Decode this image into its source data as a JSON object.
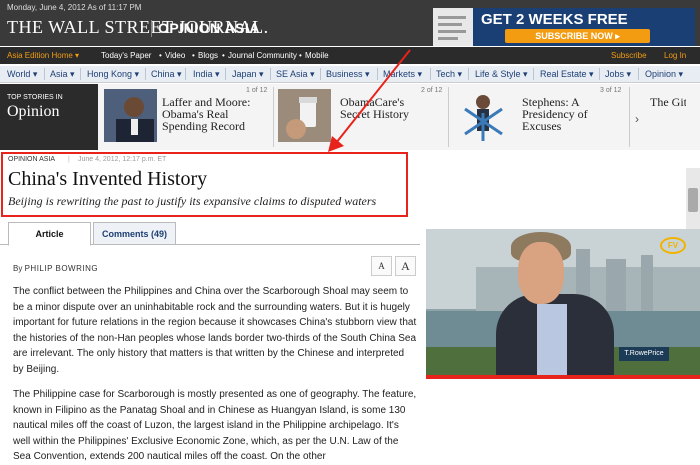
{
  "masthead": {
    "date": "Monday, June 4, 2012 As of 11:17 PM",
    "logo": "THE WALL STREET JOURNAL.",
    "section": "OPINION ASIA"
  },
  "ad": {
    "title": "GET 2 WEEKS FREE",
    "button": "SUBSCRIBE NOW ▸"
  },
  "topnav": {
    "edition": "Asia Edition Home ▾",
    "items": [
      "Today's Paper",
      "Video",
      "Blogs",
      "Journal Community",
      "Mobile"
    ],
    "subscribe": "Subscribe",
    "login": "Log In"
  },
  "secnav": {
    "items": [
      "World ▾",
      "Asia ▾",
      "Hong Kong ▾",
      "China ▾",
      "India ▾",
      "Japan ▾",
      "SE Asia ▾",
      "Business ▾",
      "Markets ▾",
      "Tech ▾",
      "Life & Style ▾",
      "Real Estate ▾",
      "Jobs ▾",
      "Opinion ▾"
    ]
  },
  "top_stories": {
    "label_small": "TOP STORIES IN",
    "label_big": "Opinion",
    "stories": [
      {
        "title": "Laffer and Moore: Obama's Real Spending Record",
        "count": "1 of 12"
      },
      {
        "title": "ObamaCare's Secret History",
        "count": "2 of 12"
      },
      {
        "title": "Stephens: A Presidency of Excuses",
        "count": "3 of 12"
      },
      {
        "title": "The Git"
      }
    ]
  },
  "article": {
    "kicker": "OPINION ASIA",
    "date": "June 4, 2012, 12:17 p.m. ET",
    "headline": "China's Invented History",
    "deck": "Beijing is rewriting the past to justify its expansive claims to disputed waters",
    "tab_article": "Article",
    "tab_comments": "Comments (49)",
    "by": "By",
    "author": "PHILIP BOWRING",
    "font_small": "A",
    "font_large": "A",
    "para1": "The conflict between the Philippines and China over the Scarborough Shoal may seem to be a minor dispute over an uninhabitable rock and the surrounding waters. But it is hugely important for future relations in the region because it showcases China's stubborn view that the histories of the non-Han peoples whose lands border two-thirds of the South China Sea are irrelevant. The only history that matters is that written by the Chinese and interpreted by Beijing.",
    "para2": "The Philippine case for Scarborough is mostly presented as one of geography. The feature, known in Filipino as the Panatag Shoal and in Chinese as Huangyan Island, is some 130 nautical miles off the coast of Luzon, the largest island in the Philippine archipelago. It's well within the Philippines' Exclusive Economic Zone, which, as per the U.N. Law of the Sea Convention, extends 200 nautical miles off the coast. On the other"
  },
  "video": {
    "logo": "FV",
    "brand": "T.RowePrice"
  },
  "colors": {
    "highlight": "#e8231b",
    "accent": "#f39c12",
    "nav_text": "#1e3f73"
  }
}
